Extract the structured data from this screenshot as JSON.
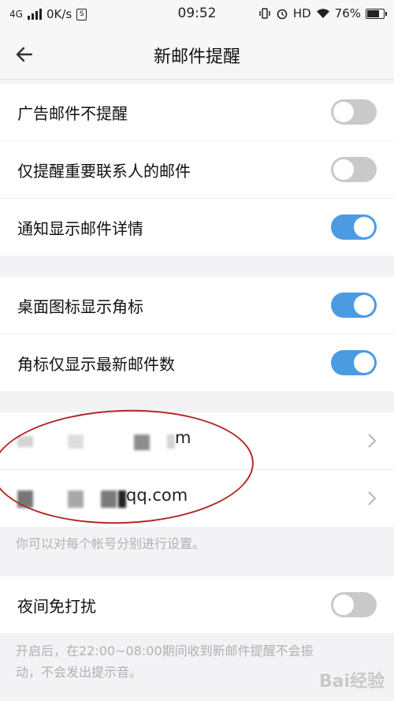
{
  "status_bar": {
    "network": "4G",
    "speed": "0K/s",
    "time": "09:52",
    "hd": "HD",
    "battery": "76%",
    "battery_level": 0.76
  },
  "header": {
    "title": "新邮件提醒"
  },
  "group1": {
    "items": [
      {
        "label": "广告邮件不提醒",
        "on": false
      },
      {
        "label": "仅提醒重要联系人的邮件",
        "on": false
      },
      {
        "label": "通知显示邮件详情",
        "on": true
      }
    ]
  },
  "group2": {
    "items": [
      {
        "label": "桌面图标显示角标",
        "on": true
      },
      {
        "label": "角标仅显示最新邮件数",
        "on": true
      }
    ]
  },
  "accounts": {
    "items": [
      {
        "visible_suffix": "m"
      },
      {
        "visible_suffix": "qq.com"
      }
    ],
    "hint": "你可以对每个帐号分别进行设置。"
  },
  "night": {
    "label": "夜间免打扰",
    "on": false,
    "hint_line1": "开启后，在22:00~08:00期间收到新邮件提醒不会振",
    "hint_line2": "动，不会发出提示音。"
  },
  "watermark": "Bai经验"
}
